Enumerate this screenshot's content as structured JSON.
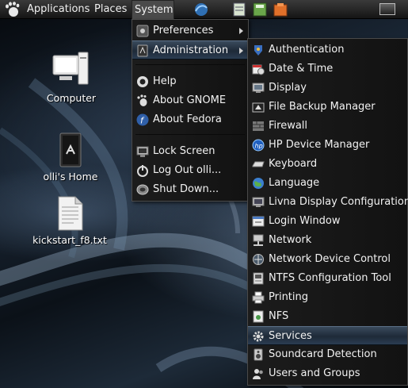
{
  "panel": {
    "applications_label": "Applications",
    "places_label": "Places",
    "system_label": "System",
    "launchers": [
      "web-browser-icon",
      "notes-icon",
      "calculator-icon",
      "box-app-icon"
    ]
  },
  "desktop": {
    "icons": [
      {
        "label": "Computer",
        "icon": "computer-icon"
      },
      {
        "label": "olli's Home",
        "icon": "home-folder-icon"
      },
      {
        "label": "kickstart_f8.txt",
        "icon": "text-file-icon"
      }
    ]
  },
  "system_menu": {
    "items": [
      {
        "label": "Preferences",
        "icon": "preferences-icon",
        "submenu": true
      },
      {
        "label": "Administration",
        "icon": "administration-icon",
        "submenu": true,
        "active": true
      },
      {
        "label": "Help",
        "icon": "help-icon"
      },
      {
        "label": "About GNOME",
        "icon": "gnome-foot-icon"
      },
      {
        "label": "About Fedora",
        "icon": "fedora-icon"
      },
      {
        "label": "Lock Screen",
        "icon": "lock-screen-icon"
      },
      {
        "label": "Log Out olli...",
        "icon": "logout-icon"
      },
      {
        "label": "Shut Down...",
        "icon": "shutdown-icon"
      }
    ]
  },
  "administration_menu": {
    "items": [
      {
        "label": "Authentication",
        "icon": "key-shield-icon"
      },
      {
        "label": "Date & Time",
        "icon": "calendar-clock-icon"
      },
      {
        "label": "Display",
        "icon": "display-icon"
      },
      {
        "label": "File Backup Manager",
        "icon": "backup-icon"
      },
      {
        "label": "Firewall",
        "icon": "firewall-icon"
      },
      {
        "label": "HP Device Manager",
        "icon": "hp-icon"
      },
      {
        "label": "Keyboard",
        "icon": "keyboard-icon"
      },
      {
        "label": "Language",
        "icon": "globe-icon"
      },
      {
        "label": "Livna Display Configuration",
        "icon": "monitor-config-icon"
      },
      {
        "label": "Login Window",
        "icon": "login-window-icon"
      },
      {
        "label": "Network",
        "icon": "network-icon"
      },
      {
        "label": "Network Device Control",
        "icon": "network-device-icon"
      },
      {
        "label": "NTFS Configuration Tool",
        "icon": "ntfs-drive-icon"
      },
      {
        "label": "Printing",
        "icon": "printer-icon"
      },
      {
        "label": "NFS",
        "icon": "nfs-icon"
      },
      {
        "label": "Services",
        "icon": "gear-icon",
        "active": true
      },
      {
        "label": "Soundcard Detection",
        "icon": "soundcard-icon"
      },
      {
        "label": "Users and Groups",
        "icon": "users-icon"
      }
    ]
  },
  "colors": {
    "panel_bg": "#1e1e1e",
    "menu_bg": "#161616",
    "highlight": "#2b3d52"
  }
}
